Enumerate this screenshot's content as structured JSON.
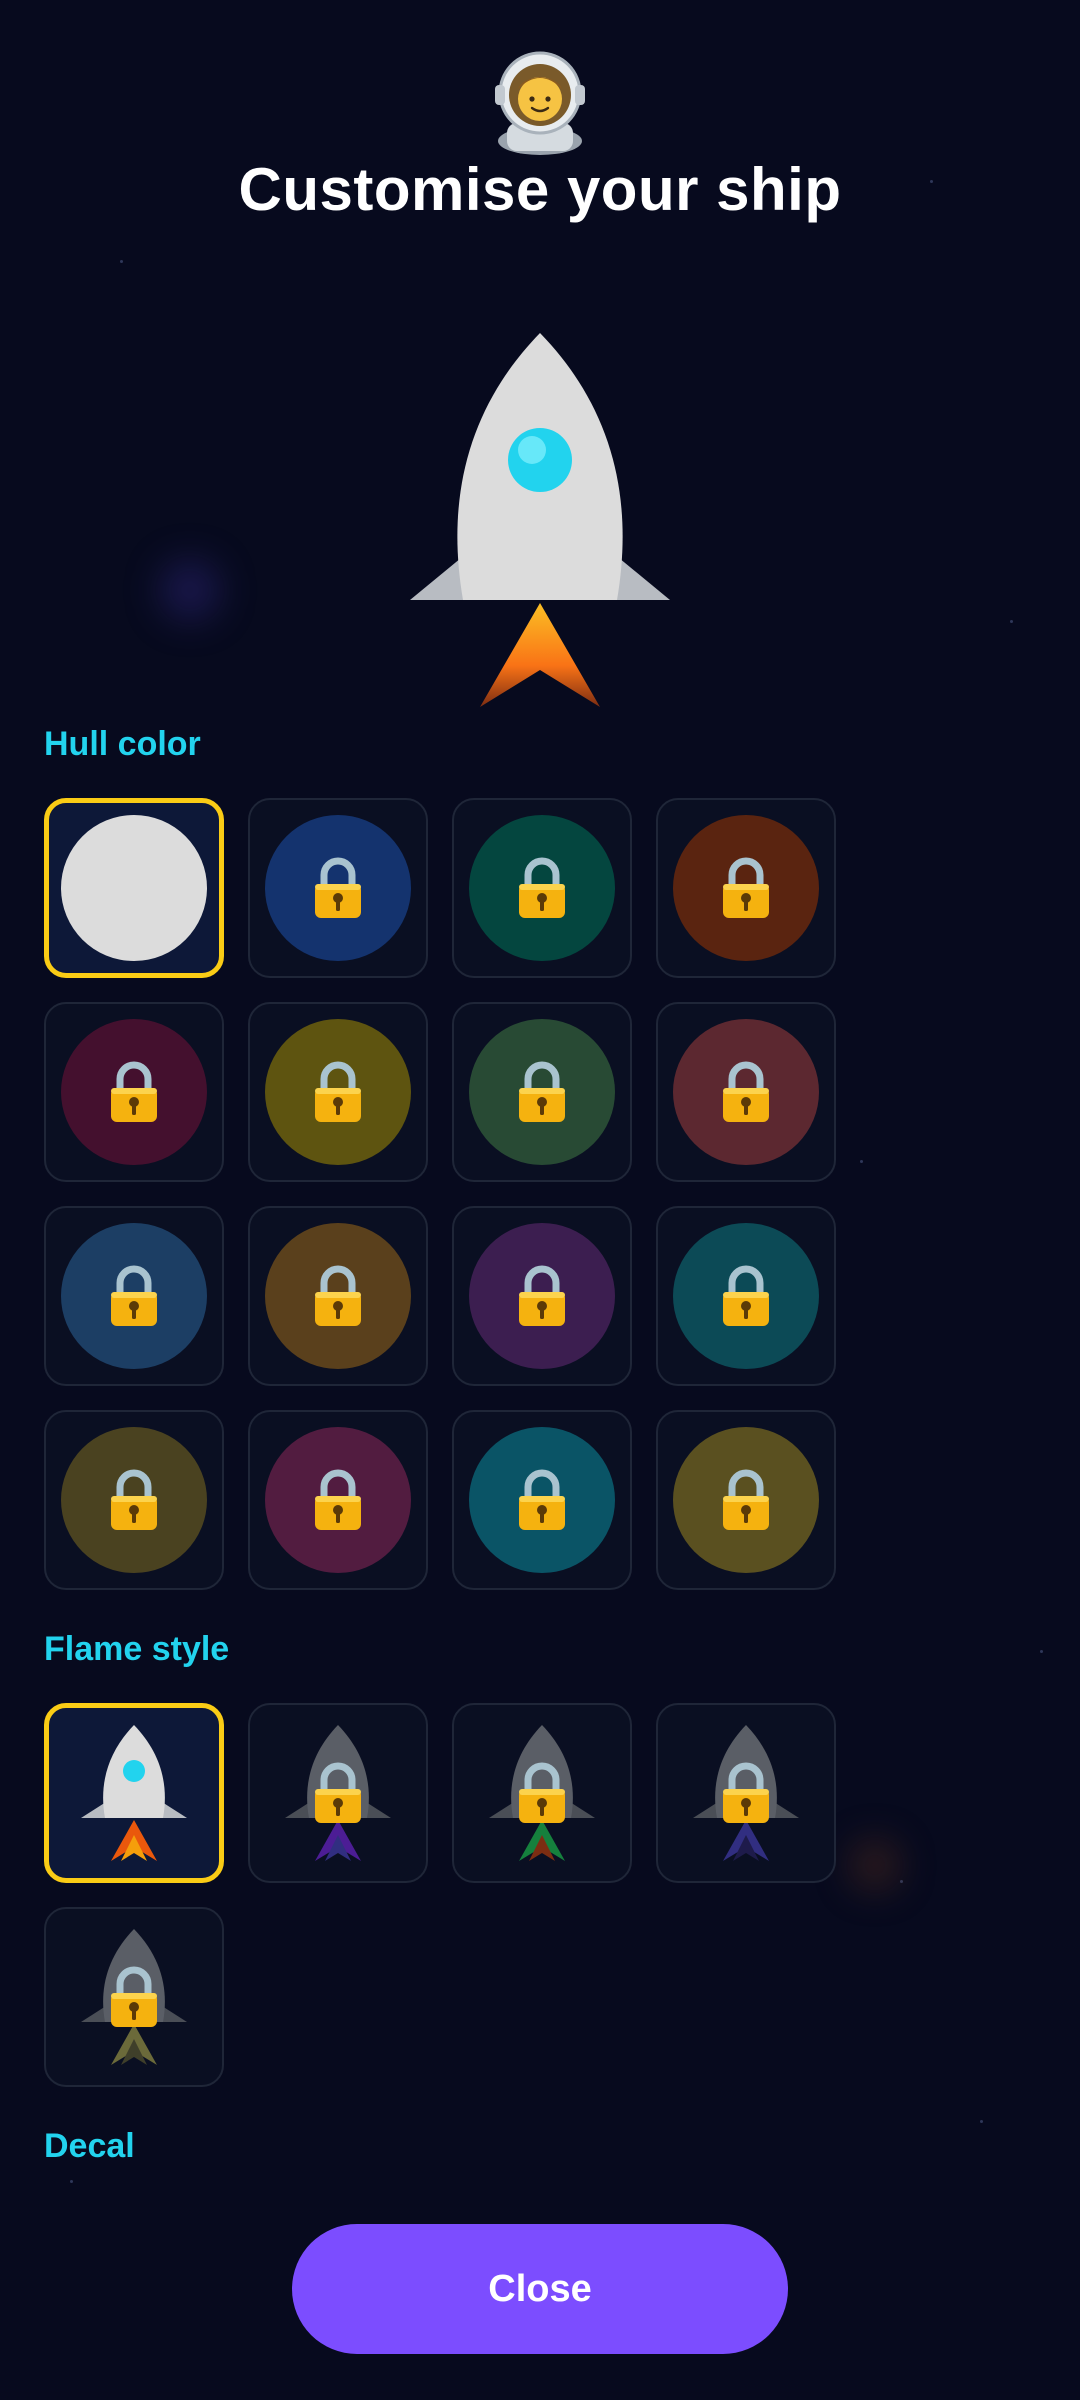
{
  "header": {
    "avatar_icon": "astronaut-icon",
    "title": "Customise your ship"
  },
  "preview": {
    "hull_color": "#dcdcdc",
    "window_color": "#22d3ee",
    "flame_color": "#f97316"
  },
  "sections": {
    "hull_color_label": "Hull color",
    "flame_style_label": "Flame style",
    "decal_label": "Decal"
  },
  "hull_colors": [
    {
      "color": "#dcdcdc",
      "selected": true,
      "locked": false
    },
    {
      "color": "#14336e",
      "selected": false,
      "locked": true
    },
    {
      "color": "#04463f",
      "selected": false,
      "locked": true
    },
    {
      "color": "#5a2410",
      "selected": false,
      "locked": true
    },
    {
      "color": "#44102e",
      "selected": false,
      "locked": true
    },
    {
      "color": "#5e5410",
      "selected": false,
      "locked": true
    },
    {
      "color": "#284a34",
      "selected": false,
      "locked": true
    },
    {
      "color": "#5c2830",
      "selected": false,
      "locked": true
    },
    {
      "color": "#1c3e64",
      "selected": false,
      "locked": true
    },
    {
      "color": "#5a401c",
      "selected": false,
      "locked": true
    },
    {
      "color": "#3c1e50",
      "selected": false,
      "locked": true
    },
    {
      "color": "#0c4a56",
      "selected": false,
      "locked": true
    },
    {
      "color": "#4a4220",
      "selected": false,
      "locked": true
    },
    {
      "color": "#521c40",
      "selected": false,
      "locked": true
    },
    {
      "color": "#0a5466",
      "selected": false,
      "locked": true
    },
    {
      "color": "#5a5020",
      "selected": false,
      "locked": true
    }
  ],
  "flame_styles": [
    {
      "flame": [
        "#ea580c",
        "#f59e0b"
      ],
      "selected": true,
      "locked": false
    },
    {
      "flame": [
        "#4c1d95",
        "#312e81"
      ],
      "selected": false,
      "locked": true
    },
    {
      "flame": [
        "#15803d",
        "#7c2d12"
      ],
      "selected": false,
      "locked": true
    },
    {
      "flame": [
        "#312e81",
        "#1e1b4b"
      ],
      "selected": false,
      "locked": true
    },
    {
      "flame": [
        "#6b6a3a",
        "#3f3f2a"
      ],
      "selected": false,
      "locked": true
    }
  ],
  "actions": {
    "close_label": "Close"
  }
}
